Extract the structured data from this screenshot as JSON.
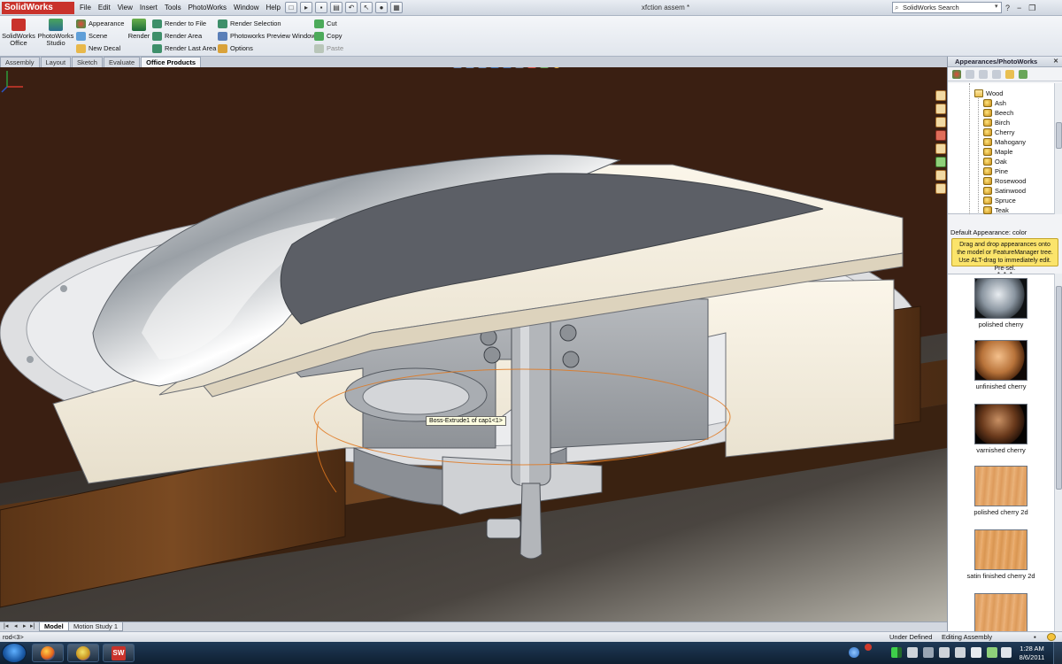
{
  "app": {
    "logo_text": "SolidWorks",
    "document_title": "xfction assem *",
    "menus": [
      "File",
      "Edit",
      "View",
      "Insert",
      "Tools",
      "PhotoWorks",
      "Window",
      "Help"
    ],
    "search_placeholder": "SolidWorks Search"
  },
  "ribbon": {
    "office_label": "SolidWorks Office",
    "studio_label": "PhotoWorks Studio",
    "render_label": "Render",
    "col1": [
      "Appearance",
      "Scene",
      "New Decal"
    ],
    "col2": [
      "Render to File",
      "Render Area",
      "Render Last Area"
    ],
    "col3": [
      "Render Selection",
      "Photoworks Preview Window",
      "Options"
    ],
    "col4": [
      "Cut",
      "Copy",
      "Paste"
    ]
  },
  "tabs": [
    "Assembly",
    "Layout",
    "Sketch",
    "Evaluate",
    "Office Products"
  ],
  "active_tab": "Office Products",
  "viewport": {
    "tooltip": "Boss-Extrude1 of cap1<1>"
  },
  "taskpane": {
    "title": "Appearances/PhotoWorks",
    "tree_folder": "Wood",
    "tree_items": [
      "Ash",
      "Beech",
      "Birch",
      "Cherry",
      "Mahogany",
      "Maple",
      "Oak",
      "Pine",
      "Rosewood",
      "Satinwood",
      "Spruce",
      "Teak"
    ],
    "default_appearance": "Default Appearance: color",
    "hint": "Drag and drop appearances onto the model or FeatureManager tree. Use ALT-drag to immediately edit. Pre-sel.",
    "swatches": [
      {
        "label": "polished cherry",
        "style": "sphere-grey"
      },
      {
        "label": "unfinished cherry",
        "style": "sphere-orange"
      },
      {
        "label": "varnished cherry",
        "style": "sphere-dark"
      },
      {
        "label": "polished cherry 2d",
        "style": "flat"
      },
      {
        "label": "satin finished cherry 2d",
        "style": "flat"
      },
      {
        "label": "",
        "style": "flat"
      }
    ]
  },
  "bottom_tabs": [
    "Model",
    "Motion Study 1"
  ],
  "status": {
    "left": "rod<3>",
    "middle": "Under Defined",
    "right": "Editing Assembly"
  },
  "taskbar": {
    "time": "1:28 AM",
    "date": "8/6/2011",
    "sw_letters": "SW"
  },
  "colors": {
    "brand_red": "#c9322b",
    "viewport_bg": "#3a1f12",
    "hint_bg": "#fbe46b"
  }
}
